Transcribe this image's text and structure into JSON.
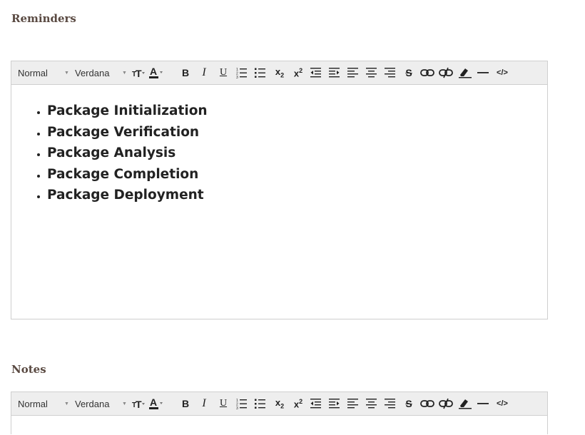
{
  "reminders": {
    "title": "Reminders",
    "items": [
      "Package Initialization",
      "Package Verification",
      "Package Analysis",
      "Package Completion",
      "Package Deployment"
    ]
  },
  "notes": {
    "title": "Notes"
  },
  "toolbar": {
    "format_value": "Normal",
    "font_value": "Verdana",
    "bold_label": "B",
    "italic_label": "I",
    "underline_label": "U",
    "strike_label": "S",
    "subscript_label": "x",
    "subscript_sub": "2",
    "superscript_label": "x",
    "superscript_sup": "2",
    "code_label": "</>",
    "icons": [
      "text-size-icon",
      "font-color-icon",
      "bold-icon",
      "italic-icon",
      "underline-icon",
      "ordered-list-icon",
      "unordered-list-icon",
      "subscript-icon",
      "superscript-icon",
      "outdent-icon",
      "indent-icon",
      "align-left-icon",
      "align-center-icon",
      "align-right-icon",
      "strikethrough-icon",
      "link-icon",
      "unlink-icon",
      "clear-format-icon",
      "horizontal-rule-icon",
      "code-view-icon"
    ]
  }
}
